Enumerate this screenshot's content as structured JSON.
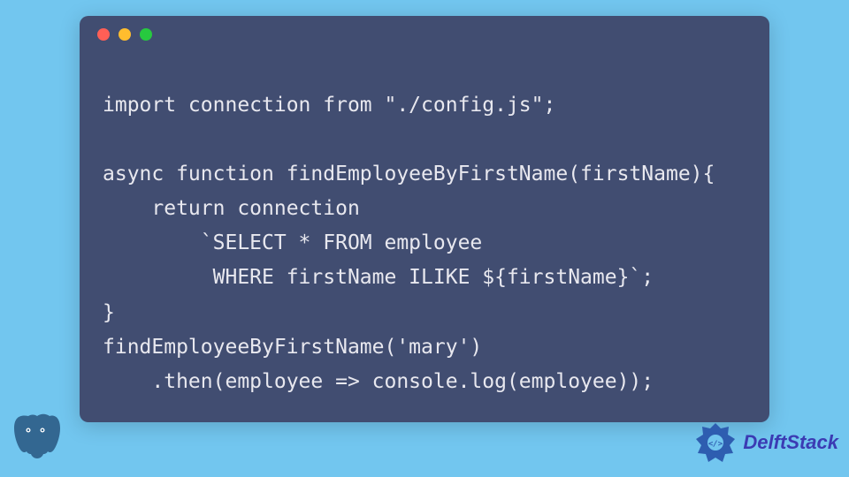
{
  "window": {
    "dots": [
      "red",
      "yellow",
      "green"
    ]
  },
  "code": {
    "lines": [
      "import connection from \"./config.js\";",
      "",
      "async function findEmployeeByFirstName(firstName){",
      "    return connection",
      "        `SELECT * FROM employee",
      "         WHERE firstName ILIKE ${firstName}`;",
      "}",
      "findEmployeeByFirstName('mary')",
      "    .then(employee => console.log(employee));"
    ]
  },
  "branding": {
    "name": "DelftStack"
  },
  "colors": {
    "page_bg": "#72c6ef",
    "window_bg": "#414d71",
    "code_text": "#e8e8ef",
    "brand_text": "#3b3bb3",
    "postgres": "#336791"
  }
}
